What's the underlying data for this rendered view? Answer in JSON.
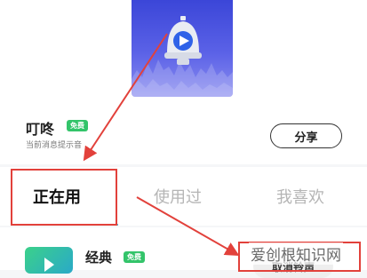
{
  "ringtone": {
    "name": "叮咚",
    "badge": "免费",
    "description": "当前消息提示音",
    "share_label": "分享",
    "cover_color": "#3b46d8"
  },
  "tabs": [
    {
      "label": "正在用",
      "active": true
    },
    {
      "label": "使用过",
      "active": false
    },
    {
      "label": "我喜欢",
      "active": false
    }
  ],
  "list": {
    "items": [
      {
        "name": "经典",
        "badge": "免费",
        "action_label": "取消铃声"
      }
    ]
  },
  "watermark": "爱创根知识网",
  "colors": {
    "accent": "#33c46a",
    "annotation": "#e2413b",
    "tab_underline": "#59b6d8"
  },
  "icons": {
    "cover": "play-bell-icon",
    "thumb": "play-icon"
  }
}
